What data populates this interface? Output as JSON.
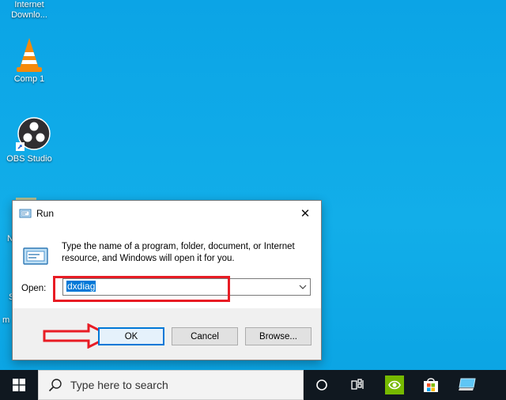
{
  "desktop": {
    "icons": [
      {
        "name": "idm",
        "label": "Internet\nDownlo..."
      },
      {
        "name": "vlc",
        "label": "Comp 1"
      },
      {
        "name": "obs",
        "label": "OBS Studio"
      }
    ],
    "partial_labels": [
      "N",
      "S",
      "m"
    ]
  },
  "run_dialog": {
    "title": "Run",
    "close_glyph": "✕",
    "description": "Type the name of a program, folder, document, or Internet resource, and Windows will open it for you.",
    "open_label": "Open:",
    "open_value": "dxdiag",
    "buttons": {
      "ok": "OK",
      "cancel": "Cancel",
      "browse": "Browse..."
    }
  },
  "taskbar": {
    "search_placeholder": "Type here to search",
    "icons": [
      "windows-start-icon",
      "search-icon",
      "cortana-icon",
      "task-view-icon",
      "nvidia-icon",
      "store-icon",
      "desktop-pc-icon"
    ]
  },
  "colors": {
    "desktop_bg": "#12aee9",
    "annotation_red": "#e81c24",
    "selection_blue": "#0078d7",
    "taskbar_bg": "#101820",
    "nvidia_green": "#76b900"
  }
}
